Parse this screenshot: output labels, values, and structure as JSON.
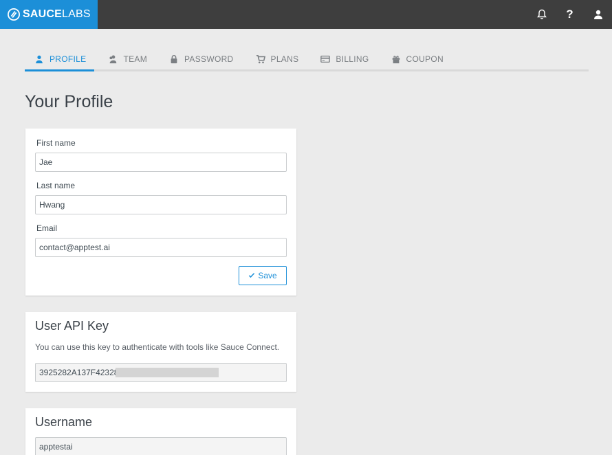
{
  "header": {
    "logo_bold": "SAUCE",
    "logo_light": "LABS",
    "icons": [
      "bell-icon",
      "help-icon",
      "user-icon"
    ],
    "help_glyph": "?"
  },
  "tabs": [
    {
      "label": "PROFILE",
      "icon": "user-icon",
      "active": true
    },
    {
      "label": "TEAM",
      "icon": "team-icon",
      "active": false
    },
    {
      "label": "PASSWORD",
      "icon": "lock-icon",
      "active": false
    },
    {
      "label": "PLANS",
      "icon": "cart-icon",
      "active": false
    },
    {
      "label": "BILLING",
      "icon": "credit-card-icon",
      "active": false
    },
    {
      "label": "COUPON",
      "icon": "gift-icon",
      "active": false
    }
  ],
  "page_title": "Your Profile",
  "profile_form": {
    "first_name_label": "First name",
    "first_name_value": "Jae",
    "last_name_label": "Last name",
    "last_name_value": "Hwang",
    "email_label": "Email",
    "email_value": "contact@apptest.ai",
    "save_label": "Save"
  },
  "api_key": {
    "title": "User API Key",
    "description": "You can use this key to authenticate with tools like Sauce Connect.",
    "value_visible": "3925282A137F42328"
  },
  "username": {
    "title": "Username",
    "value": "apptestai"
  },
  "colors": {
    "brand_blue": "#1c8fd8",
    "topbar": "#3e3e3e",
    "background": "#ebebeb"
  }
}
